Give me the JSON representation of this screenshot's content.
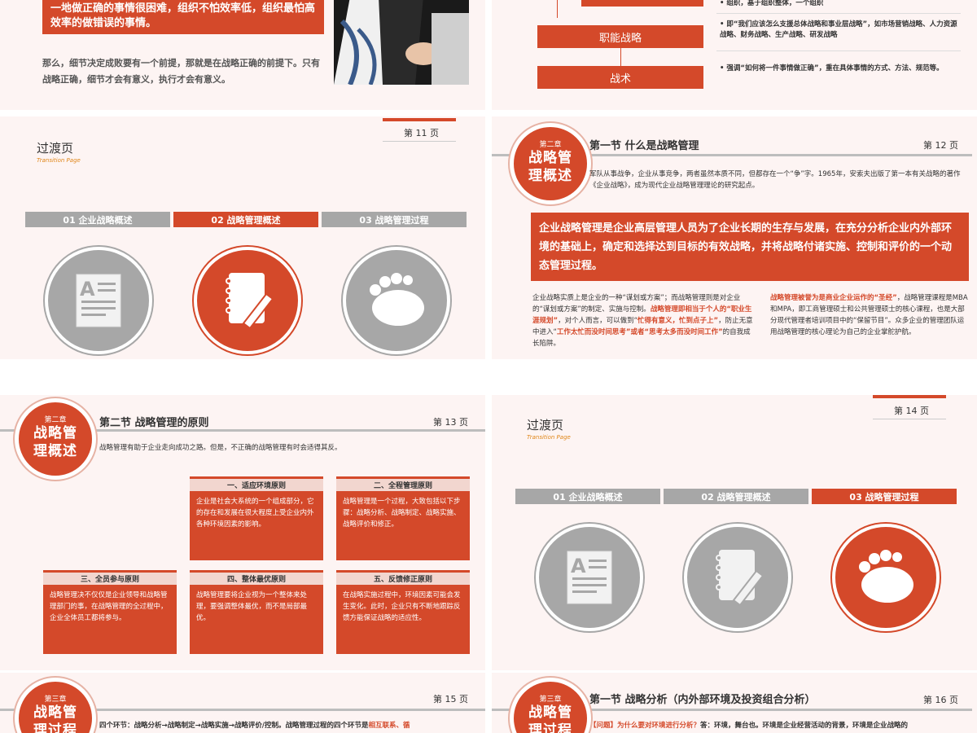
{
  "colors": {
    "accent": "#d4492a",
    "grey": "#a7a7a7"
  },
  "s10": {
    "red_text": "一地做正确的事情很困难，组织不怕效率低，组织最怕高效率的做错误的事情。",
    "body": "那么，细节决定成败要有一个前提，那就是在战略正确的前提下。只有战略正确，细节才会有意义，执行才会有意义。"
  },
  "s10b": {
    "box1": "职能战略",
    "box2": "战术",
    "top_bullet": "组织，基于组织整体，一个组织",
    "b1": "即“我们应该怎么支援总体战略和事业层战略”，如市场营销战略、人力资源战略、财务战略、生产战略、研发战略",
    "b2": "强调“如何将一件事情做正确”，重在具体事情的方式、方法、规范等。"
  },
  "s11": {
    "page": "第 11 页",
    "title": "过渡页",
    "subtitle": "Transition Page",
    "tabs": [
      "01 企业战略概述",
      "02 战略管理概述",
      "03 战略管理过程"
    ]
  },
  "s12": {
    "badge_chapter": "第二章",
    "badge_line1": "战略管",
    "badge_line2": "理概述",
    "section": "第一节  什么是战略管理",
    "page": "第 12 页",
    "intro": "军队从事战争，企业从事竞争，两者虽然本质不同，但都存在一个“争”字。1965年，安索夫出版了第一本有关战略的著作《企业战略》，成为现代企业战略管理理论的研究起点。",
    "definition": "企业战略管理是企业高层管理人员为了企业长期的生存与发展，在充分分析企业内外部环境的基础上，确定和选择达到目标的有效战略，并将战略付诸实施、控制和评价的一个动态管理过程。",
    "left_a": "企业战略实质上是企业的一种“谋划或方案”；而战略管理则是对企业的“谋划或方案”的制定、实施与控制。",
    "left_b": "战略管理即相当于个人的“职业生涯规划”",
    "left_c": "，对个人而言，可以做到“",
    "left_d": "忙得有意义，忙到点子上”",
    "left_e": "，防止无意中进入“",
    "left_f": "工作太忙而没时间思考”或者“思考太多而没时间工作”",
    "left_g": "的自我成长陷阱。",
    "right_a": "战略管理被誉为是商业企业运作的“圣经”",
    "right_b": "，战略管理课程是MBA和MPA，即工商管理硕士和公共管理硕士的核心课程，也是大部分现代管理者培训项目中的“保留节目”。众多企业的管理团队运用战略管理的核心理论为自己的企业掌舵护航。"
  },
  "s13": {
    "badge_chapter": "第二章",
    "badge_line1": "战略管",
    "badge_line2": "理概述",
    "section": "第二节  战略管理的原则",
    "page": "第 13 页",
    "intro": "战略管理有助于企业走向成功之路。但是，不正确的战略管理有时会适得其反。",
    "cards": [
      {
        "title": "一、适应环境原则",
        "body": "企业是社会大系统的一个组成部分，它的存在和发展在很大程度上受企业内外各种环境因素的影响。"
      },
      {
        "title": "二、全程管理原则",
        "body": "战略管理是一个过程，大致包括以下步骤：战略分析、战略制定、战略实施、战略评价和修正。"
      },
      {
        "title": "三、全员参与原则",
        "body": "战略管理决不仅仅是企业领导和战略管理部门的事，在战略管理的全过程中，企业全体员工都将参与。"
      },
      {
        "title": "四、整体最优原则",
        "body": "战略管理要将企业视为一个整体来处理，要强调整体最优，而不是局部最优。"
      },
      {
        "title": "五、反馈修正原则",
        "body": "在战略实施过程中，环境因素可能会发生变化。此时，企业只有不断地跟踪反馈方能保证战略的适应性。"
      }
    ]
  },
  "s14": {
    "page": "第 14 页",
    "title": "过渡页",
    "subtitle": "Transition Page",
    "tabs": [
      "01 企业战略概述",
      "02 战略管理概述",
      "03 战略管理过程"
    ]
  },
  "s15": {
    "badge_chapter": "第三章",
    "badge_line1": "战略管",
    "badge_line2": "理过程",
    "page": "第 15 页",
    "text_a": "四个环节：战略分析→战略制定→战略实施→战略评价/控制。战略管理过程的四个环节是",
    "text_b": "相互联系、循"
  },
  "s16": {
    "badge_chapter": "第三章",
    "badge_line1": "战略管",
    "badge_line2": "理过程",
    "section": "第一节  战略分析（内外部环境及投资组合分析）",
    "page": "第 16 页",
    "q": "【问题】为什么要对环境进行分析？",
    "a": "答：环境，舞台也。环境是企业经营活动的背景，环境是企业战略的"
  }
}
